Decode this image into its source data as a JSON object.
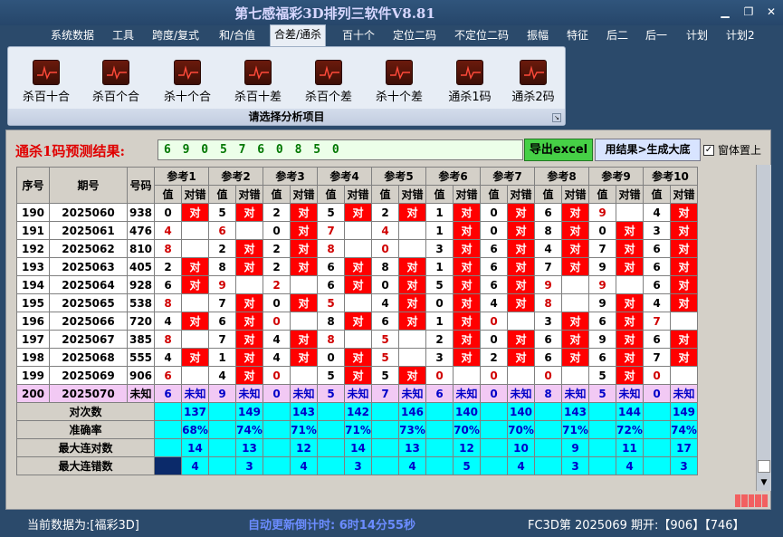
{
  "window": {
    "title": "第七感福彩3D排列三软件V8.81"
  },
  "menu": [
    "系统数据",
    "工具",
    "跨度/复式",
    "和/合值",
    "合差/通杀",
    "百十个",
    "定位二码",
    "不定位二码",
    "振幅",
    "特征",
    "后二",
    "后一",
    "计划",
    "计划2"
  ],
  "menu_active": 4,
  "ribbon": {
    "buttons": [
      "杀百十合",
      "杀百个合",
      "杀十个合",
      "杀百十差",
      "杀百个差",
      "杀十个差",
      "通杀1码",
      "通杀2码"
    ],
    "group_label": "请选择分析项目"
  },
  "prediction": {
    "label": "通杀1码预测结果:",
    "value": "6 9 0 5 7 6 0 8 5 0",
    "export_button": "导出excel",
    "generate_button": "用结果>生成大底",
    "topmost_label": "窗体置上",
    "topmost_checked": true
  },
  "table": {
    "headers": {
      "index": "序号",
      "issue": "期号",
      "number": "号码",
      "refs": [
        "参考1",
        "参考2",
        "参考3",
        "参考4",
        "参考5",
        "参考6",
        "参考7",
        "参考8",
        "参考9",
        "参考10"
      ],
      "value": "值",
      "result": "对错"
    },
    "hit_text": "对",
    "unknown_text": "未知",
    "rows": [
      {
        "index": "190",
        "issue": "2025060",
        "number": "938",
        "values": [
          "0",
          "5",
          "2",
          "5",
          "2",
          "1",
          "0",
          "6",
          "9",
          "4"
        ],
        "hits": [
          1,
          1,
          1,
          1,
          1,
          1,
          1,
          1,
          0,
          1
        ]
      },
      {
        "index": "191",
        "issue": "2025061",
        "number": "476",
        "values": [
          "4",
          "6",
          "0",
          "7",
          "4",
          "1",
          "0",
          "8",
          "0",
          "3"
        ],
        "hits": [
          0,
          0,
          1,
          0,
          0,
          1,
          1,
          1,
          1,
          1
        ]
      },
      {
        "index": "192",
        "issue": "2025062",
        "number": "810",
        "values": [
          "8",
          "2",
          "2",
          "8",
          "0",
          "3",
          "6",
          "4",
          "7",
          "6"
        ],
        "hits": [
          0,
          1,
          1,
          0,
          0,
          1,
          1,
          1,
          1,
          1
        ]
      },
      {
        "index": "193",
        "issue": "2025063",
        "number": "405",
        "values": [
          "2",
          "8",
          "2",
          "6",
          "8",
          "1",
          "6",
          "7",
          "9",
          "6"
        ],
        "hits": [
          1,
          1,
          1,
          1,
          1,
          1,
          1,
          1,
          1,
          1
        ]
      },
      {
        "index": "194",
        "issue": "2025064",
        "number": "928",
        "values": [
          "6",
          "9",
          "2",
          "6",
          "0",
          "5",
          "6",
          "9",
          "9",
          "6"
        ],
        "hits": [
          1,
          0,
          0,
          1,
          1,
          1,
          1,
          0,
          0,
          1
        ]
      },
      {
        "index": "195",
        "issue": "2025065",
        "number": "538",
        "values": [
          "8",
          "7",
          "0",
          "5",
          "4",
          "0",
          "4",
          "8",
          "9",
          "4"
        ],
        "hits": [
          0,
          1,
          1,
          0,
          1,
          1,
          1,
          0,
          1,
          1
        ]
      },
      {
        "index": "196",
        "issue": "2025066",
        "number": "720",
        "values": [
          "4",
          "6",
          "0",
          "8",
          "6",
          "1",
          "0",
          "3",
          "6",
          "7"
        ],
        "hits": [
          1,
          1,
          0,
          1,
          1,
          1,
          0,
          1,
          1,
          0
        ]
      },
      {
        "index": "197",
        "issue": "2025067",
        "number": "385",
        "values": [
          "8",
          "7",
          "4",
          "8",
          "5",
          "2",
          "0",
          "6",
          "9",
          "6"
        ],
        "hits": [
          0,
          1,
          1,
          0,
          0,
          1,
          1,
          1,
          1,
          1
        ]
      },
      {
        "index": "198",
        "issue": "2025068",
        "number": "555",
        "values": [
          "4",
          "1",
          "4",
          "0",
          "5",
          "3",
          "2",
          "6",
          "6",
          "7"
        ],
        "hits": [
          1,
          1,
          1,
          1,
          0,
          1,
          1,
          1,
          1,
          1
        ]
      },
      {
        "index": "199",
        "issue": "2025069",
        "number": "906",
        "values": [
          "6",
          "4",
          "0",
          "5",
          "5",
          "0",
          "0",
          "0",
          "5",
          "0"
        ],
        "hits": [
          0,
          1,
          0,
          1,
          1,
          0,
          0,
          0,
          1,
          0
        ]
      }
    ],
    "future_row": {
      "index": "200",
      "issue": "2025070",
      "number": "未知",
      "values": [
        "6",
        "9",
        "0",
        "5",
        "7",
        "6",
        "0",
        "8",
        "5",
        "0"
      ]
    },
    "summary": [
      {
        "label": "对次数",
        "values": [
          "137",
          "149",
          "143",
          "142",
          "146",
          "140",
          "140",
          "143",
          "144",
          "149"
        ]
      },
      {
        "label": "准确率",
        "values": [
          "68%",
          "74%",
          "71%",
          "71%",
          "73%",
          "70%",
          "70%",
          "71%",
          "72%",
          "74%"
        ]
      },
      {
        "label": "最大连对数",
        "values": [
          "14",
          "13",
          "12",
          "14",
          "13",
          "12",
          "10",
          "9",
          "11",
          "17"
        ]
      },
      {
        "label": "最大连错数",
        "values": [
          "4",
          "3",
          "4",
          "3",
          "4",
          "5",
          "4",
          "3",
          "4",
          "3"
        ]
      }
    ]
  },
  "status": {
    "current": "当前数据为:[福彩3D]",
    "countdown": "自动更新倒计时: 6时14分55秒",
    "issue_info": "FC3D第 2025069 期开:【906】【746】"
  },
  "colors": {
    "hit": "#ff0000",
    "summary": "#00ffff",
    "future": "#f2c9f4",
    "prediction": "#007700",
    "countdown": "#6b8cff"
  }
}
